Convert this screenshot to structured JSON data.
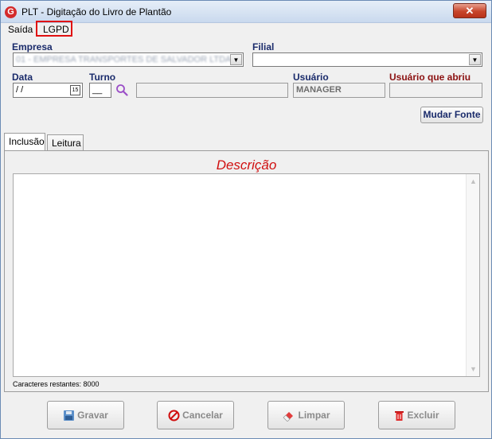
{
  "window": {
    "title": "PLT - Digitação do Livro de Plantão",
    "close_glyph": "✕"
  },
  "menu": {
    "items": [
      {
        "label": "Saída"
      },
      {
        "label": "LGPD"
      }
    ]
  },
  "form": {
    "empresa_label": "Empresa",
    "empresa_value": "01 - EMPRESA TRANSPORTES DE SALVADOR LTDA",
    "filial_label": "Filial",
    "filial_value": "",
    "data_label": "Data",
    "data_value": " / /",
    "calendar_glyph": "15",
    "turno_label": "Turno",
    "turno_value": "__",
    "turno_desc": "",
    "usuario_label": "Usuário",
    "usuario_value": "MANAGER",
    "usuario_abriu_label": "Usuário que abriu",
    "usuario_abriu_value": "",
    "mudar_fonte_label": "Mudar Fonte"
  },
  "tabs": [
    {
      "label": "Inclusão",
      "active": true
    },
    {
      "label": "Leitura",
      "active": false
    }
  ],
  "description": {
    "title": "Descrição",
    "text": "",
    "chars_remaining": "Caracteres restantes: 8000"
  },
  "buttons": {
    "gravar": "Gravar",
    "cancelar": "Cancelar",
    "limpar": "Limpar",
    "excluir": "Excluir"
  },
  "colors": {
    "label_blue": "#1a2b6b",
    "label_red": "#8b1010",
    "title_red": "#d01010",
    "highlight": "#e01010"
  }
}
